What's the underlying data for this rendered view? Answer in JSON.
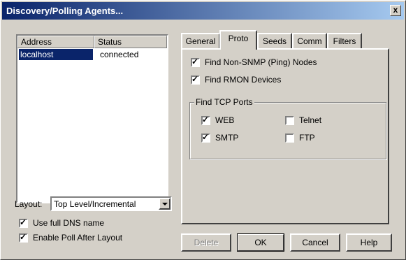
{
  "window": {
    "title": "Discovery/Polling Agents...",
    "close_label": "x"
  },
  "agents_list": {
    "columns": [
      "Address",
      "Status"
    ],
    "rows": [
      {
        "address": "localhost",
        "status": "connected"
      }
    ]
  },
  "layout": {
    "label": "Layout:",
    "value": "Top Level/Incremental"
  },
  "options": {
    "use_full_dns": {
      "label": "Use full DNS name",
      "checked": true
    },
    "enable_poll": {
      "label": "Enable Poll After Layout",
      "checked": true
    }
  },
  "tabs": [
    "General",
    "Proto",
    "Seeds",
    "Comm",
    "Filters"
  ],
  "active_tab": "Proto",
  "proto": {
    "find_non_snmp": {
      "label": "Find Non-SNMP (Ping) Nodes",
      "checked": true
    },
    "find_rmon": {
      "label": "Find RMON Devices",
      "checked": true
    },
    "tcp_group_title": "Find TCP Ports",
    "web": {
      "label": "WEB",
      "checked": true
    },
    "telnet": {
      "label": "Telnet",
      "checked": false
    },
    "smtp": {
      "label": "SMTP",
      "checked": true
    },
    "ftp": {
      "label": "FTP",
      "checked": false
    }
  },
  "buttons": {
    "delete": "Delete",
    "ok": "OK",
    "cancel": "Cancel",
    "help": "Help"
  },
  "check_glyph": "✓"
}
